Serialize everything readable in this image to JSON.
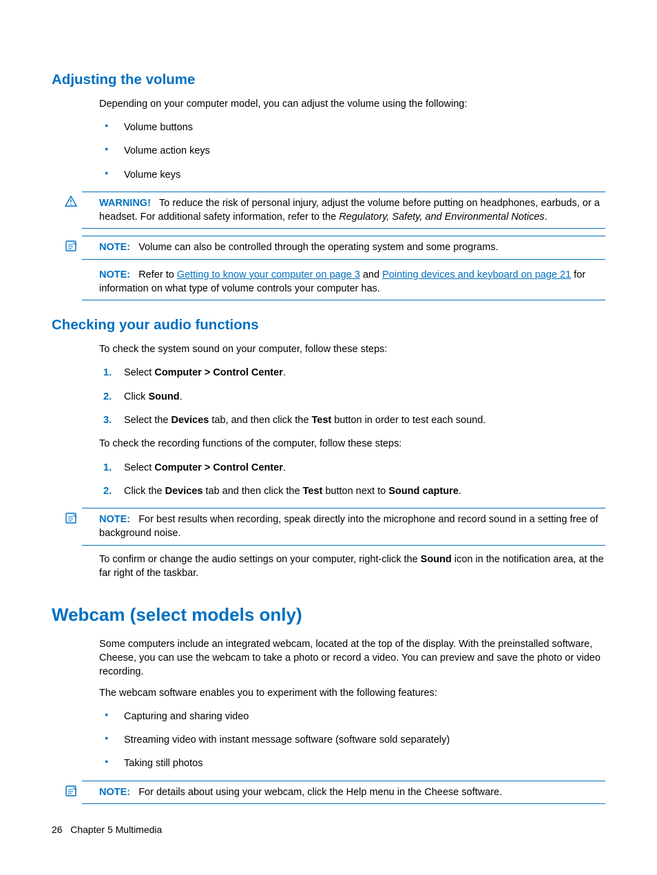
{
  "sections": {
    "adjusting_volume": {
      "heading": "Adjusting the volume",
      "intro": "Depending on your computer model, you can adjust the volume using the following:",
      "bullets": [
        "Volume buttons",
        "Volume action keys",
        "Volume keys"
      ],
      "warning": {
        "label": "WARNING!",
        "text_before": "To reduce the risk of personal injury, adjust the volume before putting on headphones, earbuds, or a headset. For additional safety information, refer to the ",
        "italic": "Regulatory, Safety, and Environmental Notices",
        "text_after": "."
      },
      "note1": {
        "label": "NOTE:",
        "text": "Volume can also be controlled through the operating system and some programs."
      },
      "note2": {
        "label": "NOTE:",
        "pre": "Refer to ",
        "link1": "Getting to know your computer on page 3",
        "mid": " and ",
        "link2": "Pointing devices and keyboard on page 21",
        "post": " for information on what type of volume controls your computer has."
      }
    },
    "checking_audio": {
      "heading": "Checking your audio functions",
      "intro": "To check the system sound on your computer, follow these steps:",
      "steps1": {
        "s1a": "Select ",
        "s1b": "Computer > Control Center",
        "s1c": ".",
        "s2a": "Click ",
        "s2b": "Sound",
        "s2c": ".",
        "s3a": "Select the ",
        "s3b": "Devices",
        "s3c": " tab, and then click the ",
        "s3d": "Test",
        "s3e": " button in order to test each sound."
      },
      "intro2": "To check the recording functions of the computer, follow these steps:",
      "steps2": {
        "s1a": "Select ",
        "s1b": "Computer > Control Center",
        "s1c": ".",
        "s2a": "Click the ",
        "s2b": "Devices",
        "s2c": " tab and then click the ",
        "s2d": "Test",
        "s2e": " button next to ",
        "s2f": "Sound capture",
        "s2g": "."
      },
      "note": {
        "label": "NOTE:",
        "text": "For best results when recording, speak directly into the microphone and record sound in a setting free of background noise."
      },
      "confirm_a": "To confirm or change the audio settings on your computer, right-click the ",
      "confirm_b": "Sound",
      "confirm_c": " icon in the notification area, at the far right of the taskbar."
    },
    "webcam": {
      "heading": "Webcam (select models only)",
      "p1": "Some computers include an integrated webcam, located at the top of the display. With the preinstalled software, Cheese, you can use the webcam to take a photo or record a video. You can preview and save the photo or video recording.",
      "p2": "The webcam software enables you to experiment with the following features:",
      "bullets": [
        "Capturing and sharing video",
        "Streaming video with instant message software (software sold separately)",
        "Taking still photos"
      ],
      "note": {
        "label": "NOTE:",
        "text": "For details about using your webcam, click the Help menu in the Cheese software."
      }
    }
  },
  "footer": {
    "page": "26",
    "chapter": "Chapter 5   Multimedia"
  }
}
